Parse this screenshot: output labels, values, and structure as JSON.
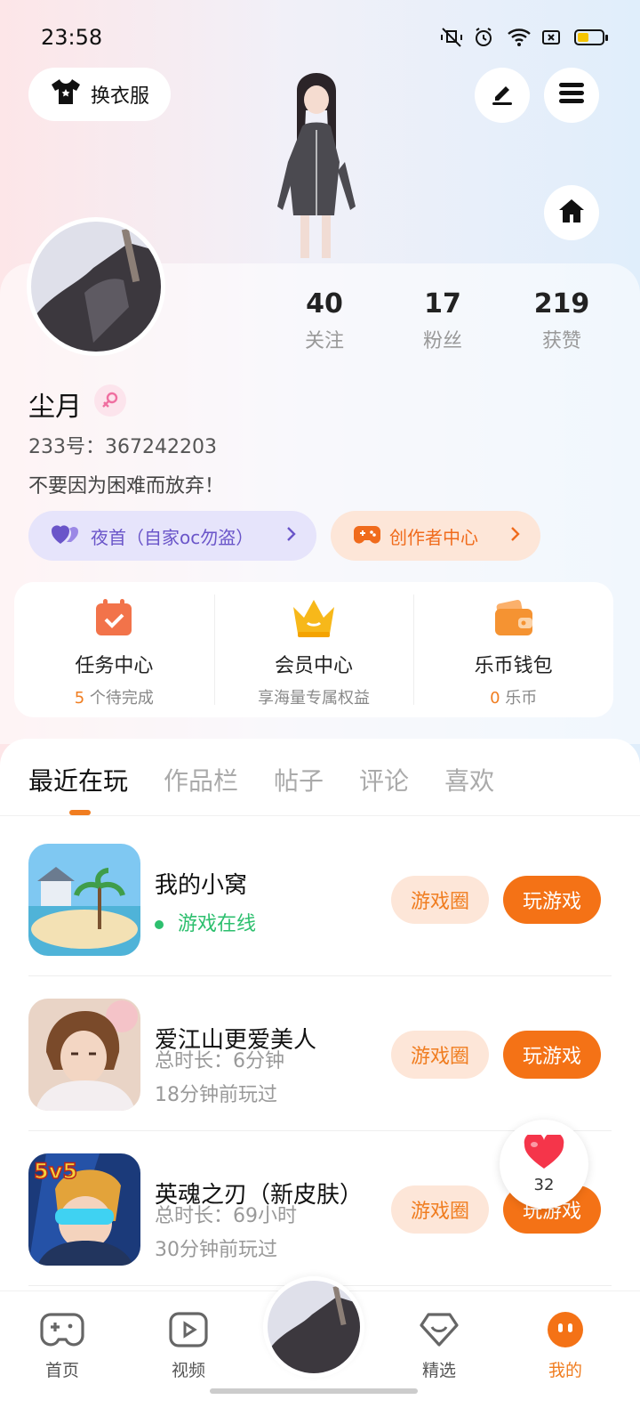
{
  "status_bar": {
    "time": "23:58"
  },
  "header": {
    "outfit_label": "换衣服",
    "edit_icon": "pen-icon",
    "menu_icon": "menu-icon",
    "home_icon": "home-icon"
  },
  "profile": {
    "following_count": "40",
    "following_label": "关注",
    "fans_count": "17",
    "fans_label": "粉丝",
    "likes_count": "219",
    "likes_label": "获赞",
    "username": "尘月",
    "uid": "233号：367242203",
    "bio": "不要因为困难而放弃！",
    "oc_label": "夜首（自家oc勿盗）",
    "creator_label": "创作者中心"
  },
  "quick_links": [
    {
      "title": "任务中心",
      "count": "5",
      "sub": " 个待完成"
    },
    {
      "title": "会员中心",
      "sub": "享海量专属权益"
    },
    {
      "title": "乐币钱包",
      "count": "0",
      "sub": " 乐币"
    }
  ],
  "tabs": [
    "最近在玩",
    "作品栏",
    "帖子",
    "评论",
    "喜欢"
  ],
  "games": [
    {
      "name": "我的小窝",
      "status": "游戏在线",
      "circle_label": "游戏圈",
      "play_label": "玩游戏"
    },
    {
      "name": "爱江山更爱美人",
      "duration": "总时长：6分钟",
      "last_played": "18分钟前玩过",
      "circle_label": "游戏圈",
      "play_label": "玩游戏"
    },
    {
      "name": "英魂之刃（新皮肤）",
      "duration": "总时长：69小时",
      "last_played": "30分钟前玩过",
      "circle_label": "游戏圈",
      "play_label": "玩游戏"
    }
  ],
  "game_icon_badge": "5v5",
  "like_float": {
    "count": "32"
  },
  "bottom_nav": {
    "home": "首页",
    "video": "视频",
    "featured": "精选",
    "mine": "我的"
  }
}
